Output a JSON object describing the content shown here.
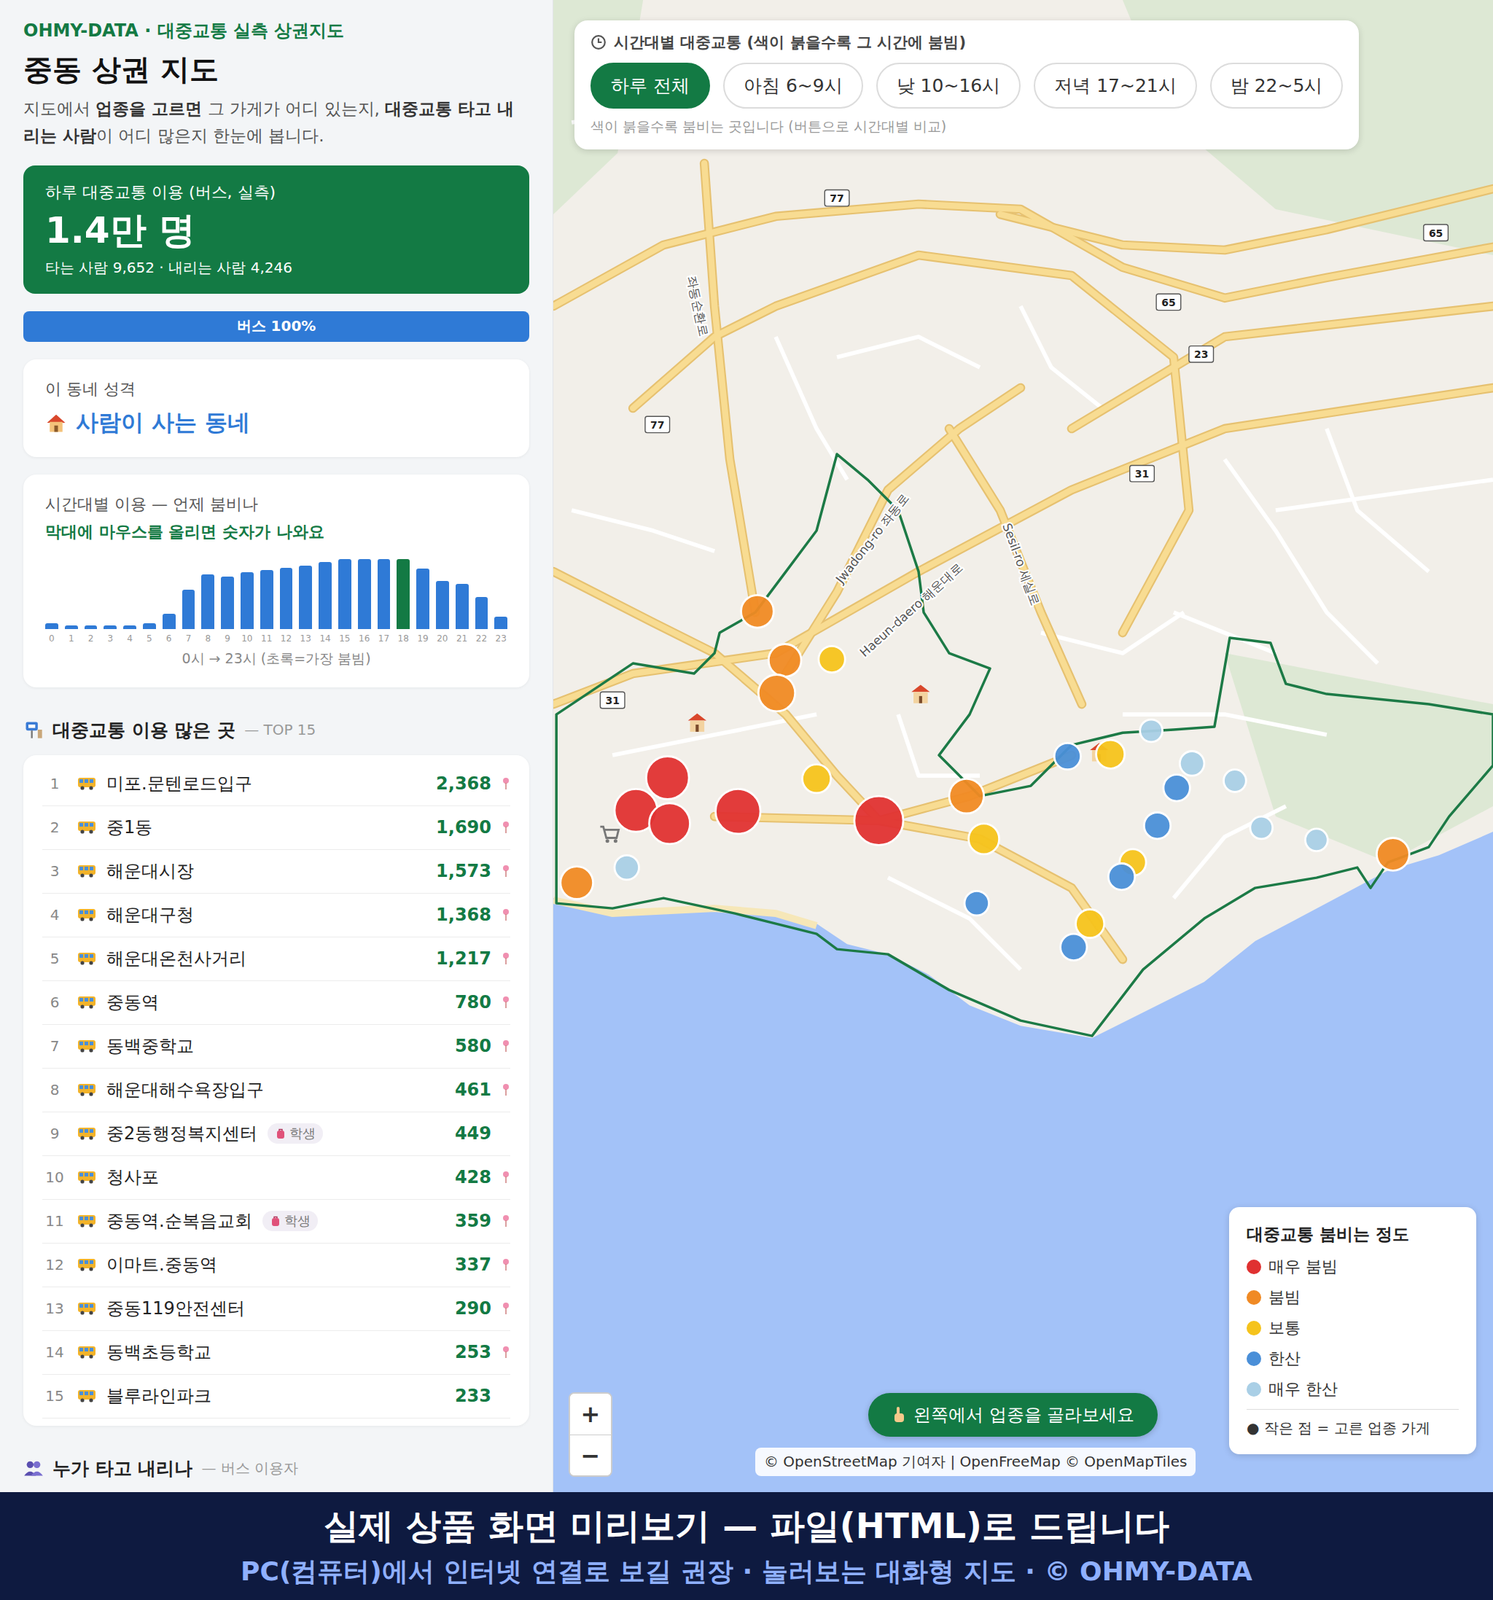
{
  "header": {
    "brand": "OHMY-DATA · 대중교통 실측 상권지도",
    "title": "중동 상권 지도",
    "description": [
      {
        "text": "지도에서 ",
        "bold": false
      },
      {
        "text": "업종을 고르면",
        "bold": true
      },
      {
        "text": " 그 가게가 어디 있는지, ",
        "bold": false
      },
      {
        "text": "대중교통 타고 내리는 사람",
        "bold": true
      },
      {
        "text": "이 어디 많은지 한눈에 봅니다.",
        "bold": false
      }
    ]
  },
  "summary": {
    "label": "하루 대중교통 이용 (버스, 실측)",
    "total": "1.4만 명",
    "detail": "타는 사람 9,652 · 내리는 사람 4,246"
  },
  "modes": [
    {
      "label": "버스 100%",
      "level": 1.0,
      "color": "#2f7ad6"
    }
  ],
  "character": {
    "label": "이 동네 성격",
    "value": "사람이 사는 동네"
  },
  "hourly_chart": {
    "title": "시간대별 이용 — 언제 붐비나",
    "hint": "막대에 마우스를 올리면 숫자가 나와요",
    "ticks": [
      "0",
      "1",
      "2",
      "3",
      "4",
      "5",
      "6",
      "7",
      "8",
      "9",
      "10",
      "11",
      "12",
      "13",
      "14",
      "15",
      "16",
      "17",
      "18",
      "19",
      "20",
      "21",
      "22",
      "23"
    ],
    "values": [
      78,
      47,
      47,
      47,
      47,
      78,
      220,
      565,
      784,
      753,
      816,
      847,
      878,
      910,
      957,
      998,
      1000,
      1002,
      1006,
      863,
      690,
      643,
      455,
      173
    ],
    "caption": "0시 → 23시 (초록=가장 붐빔)"
  },
  "top_stops": {
    "title": "대중교통 이용 많은 곳",
    "subtitle": "— TOP 15",
    "rows": [
      {
        "rank": "1",
        "name": "미포.문텐로드입구",
        "count": "2,368",
        "pin": true
      },
      {
        "rank": "2",
        "name": "중1동",
        "count": "1,690",
        "pin": true
      },
      {
        "rank": "3",
        "name": "해운대시장",
        "count": "1,573",
        "pin": true
      },
      {
        "rank": "4",
        "name": "해운대구청",
        "count": "1,368",
        "pin": true
      },
      {
        "rank": "5",
        "name": "해운대온천사거리",
        "count": "1,217",
        "pin": true
      },
      {
        "rank": "6",
        "name": "중동역",
        "count": "780",
        "pin": true
      },
      {
        "rank": "7",
        "name": "동백중학교",
        "count": "580",
        "pin": true
      },
      {
        "rank": "8",
        "name": "해운대해수욕장입구",
        "count": "461",
        "pin": true
      },
      {
        "rank": "9",
        "name": "중2동행정복지센터",
        "badge": "학생",
        "count": "449",
        "pin": false
      },
      {
        "rank": "10",
        "name": "청사포",
        "count": "428",
        "pin": true
      },
      {
        "rank": "11",
        "name": "중동역.순복음교회",
        "badge": "학생",
        "count": "359",
        "pin": true
      },
      {
        "rank": "12",
        "name": "이마트.중동역",
        "count": "337",
        "pin": true
      },
      {
        "rank": "13",
        "name": "중동119안전센터",
        "count": "290",
        "pin": true
      },
      {
        "rank": "14",
        "name": "동백초등학교",
        "count": "253",
        "pin": true
      },
      {
        "rank": "15",
        "name": "블루라인파크",
        "count": "233",
        "pin": false
      }
    ]
  },
  "riders_section": {
    "title": "누가 타고 내리나",
    "subtitle": "— 버스 이용자"
  },
  "map": {
    "time_filter": {
      "title": "시간대별 대중교통 (색이 붉을수록 그 시간에 붐빔)",
      "options": [
        {
          "label": "하루 전체",
          "selected": true
        },
        {
          "label": "아침 6~9시",
          "selected": false
        },
        {
          "label": "낮 10~16시",
          "selected": false
        },
        {
          "label": "저녁 17~21시",
          "selected": false
        },
        {
          "label": "밤 22~5시",
          "selected": false
        }
      ],
      "hint": "색이 붉을수록 붐비는 곳입니다 (버튼으로 시간대별 비교)"
    },
    "road_shields": [
      "77",
      "77",
      "65",
      "65",
      "23",
      "31",
      "31"
    ],
    "street_labels": [
      "좌동순환로",
      "Jwadong-ro 좌동로",
      "Haeun-daero 해운대로",
      "Sesil-ro 세실로"
    ],
    "markers": [
      {
        "color": "#f08a24"
      },
      {
        "color": "#f08a24"
      },
      {
        "color": "#f5c31c"
      },
      {
        "color": "#f08a24"
      },
      {
        "color": "#e03131"
      },
      {
        "color": "#e03131"
      },
      {
        "color": "#e03131"
      },
      {
        "color": "#e03131"
      },
      {
        "color": "#f5c31c"
      },
      {
        "color": "#e03131"
      },
      {
        "color": "#f08a24"
      },
      {
        "color": "#f5c31c"
      },
      {
        "color": "#f08a24"
      },
      {
        "color": "#a9cfe6"
      },
      {
        "color": "#4a8fd8"
      },
      {
        "color": "#f5c31c"
      },
      {
        "color": "#a9cfe6"
      },
      {
        "color": "#a9cfe6"
      },
      {
        "color": "#4a8fd8"
      },
      {
        "color": "#a9cfe6"
      },
      {
        "color": "#4a8fd8"
      },
      {
        "color": "#f5c31c"
      },
      {
        "color": "#4a8fd8"
      },
      {
        "color": "#a9cfe6"
      },
      {
        "color": "#a9cfe6"
      },
      {
        "color": "#f08a24"
      },
      {
        "color": "#4a8fd8"
      },
      {
        "color": "#f5c31c"
      },
      {
        "color": "#4a8fd8"
      }
    ],
    "legend": {
      "title": "대중교통 붐비는 정도",
      "items": [
        {
          "label": "매우 붐빔",
          "color": "#e03131"
        },
        {
          "label": "붐빔",
          "color": "#f08a24"
        },
        {
          "label": "보통",
          "color": "#f5c31c"
        },
        {
          "label": "한산",
          "color": "#4a8fd8"
        },
        {
          "label": "매우 한산",
          "color": "#a9cfe6"
        }
      ],
      "note": "● 작은 점 = 고른 업종 가게"
    },
    "category_button": "왼쪽에서 업종을 골라보세요",
    "zoom": [
      "+",
      "−"
    ],
    "attribution": "© OpenStreetMap 기여자 | OpenFreeMap © OpenMapTiles"
  },
  "banner": {
    "title": "실제 상품 화면 미리보기 — 파일(HTML)로 드립니다",
    "subtitle": "PC(컴퓨터)에서 인터넷 연결로 보길 권장 · 눌러보는 대화형 지도 · © OHMY-DATA"
  }
}
